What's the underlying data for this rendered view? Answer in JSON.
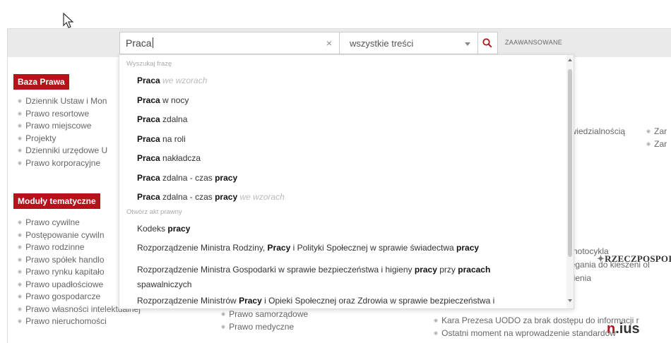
{
  "search": {
    "query": "Praca",
    "clear_icon": "×",
    "scope": "wszystkie treści",
    "advanced_label": "ZAAWANSOWANE"
  },
  "left": {
    "baza_prawa": {
      "title": "Baza Prawa",
      "items": [
        "Dziennik Ustaw i Mon",
        "Prawo resortowe",
        "Prawo miejscowe",
        "Projekty",
        "Dzienniki urzędowe U",
        "Prawo korporacyjne"
      ]
    },
    "moduly": {
      "title": "Moduły tematyczne",
      "items": [
        "Prawo cywilne",
        "Postępowanie cywiln",
        "Prawo rodzinne",
        "Prawo spółek handlo",
        "Prawo rynku kapitało",
        "Prawo upadłościowe",
        "Prawo gospodarcze",
        "Prawo własności intelektualnej",
        "Prawo nieruchomości"
      ]
    },
    "moduly_col2": [
      "Prawo samorządowe",
      "Prawo medyczne"
    ]
  },
  "right": {
    "text1": "owiedzialnością",
    "text2": "Zar",
    "text3": "Zar",
    "rzeczpospolita": "RZECZPOSPOI",
    "line1": "notocykla",
    "line2": "sięgania do kieszeni ol",
    "line3": "nienia",
    "nius_n": "n",
    "nius_rest": ".ius",
    "news1": "Kara Prezesa UODO za brak dostępu do informacji r",
    "news2": "Ostatni  moment  na  wprowadzenie  standardów"
  },
  "dropdown": {
    "header_phrase": "Wyszukaj frazę",
    "header_act": "Otwórz akt prawny",
    "s1": {
      "b": "Praca",
      "em": "we wzorach"
    },
    "s2": {
      "b": "Praca",
      "t": "w nocy"
    },
    "s3": {
      "b": "Praca",
      "t": "zdalna"
    },
    "s4": {
      "b": "Praca",
      "t": "na roli"
    },
    "s5": {
      "b": "Praca",
      "t": "nakładcza"
    },
    "s6": {
      "b": "Praca",
      "t": "zdalna - czas",
      "b2": "pracy"
    },
    "s7": {
      "b": "Praca",
      "t": "zdalna - czas",
      "b2": "pracy",
      "em": "we wzorach"
    },
    "a1": {
      "t": "Kodeks",
      "b": "pracy"
    },
    "a2": {
      "t1": "Rozporządzenie Ministra Rodziny,",
      "b1": "Pracy",
      "t2": "i Polityki Społecznej w sprawie świadectwa",
      "b2": "pracy"
    },
    "a3": {
      "t1": "Rozporządzenie Ministra Gospodarki w sprawie bezpieczeństwa i higieny",
      "b1": "pracy",
      "t2": "przy",
      "b2": "pracach",
      "t3": "spawalniczych"
    },
    "a4": {
      "t1": "Rozporządzenie Ministrów",
      "b1": "Pracy",
      "t2": "i Opieki Społecznej oraz Zdrowia w sprawie bezpieczeństwa i"
    }
  }
}
